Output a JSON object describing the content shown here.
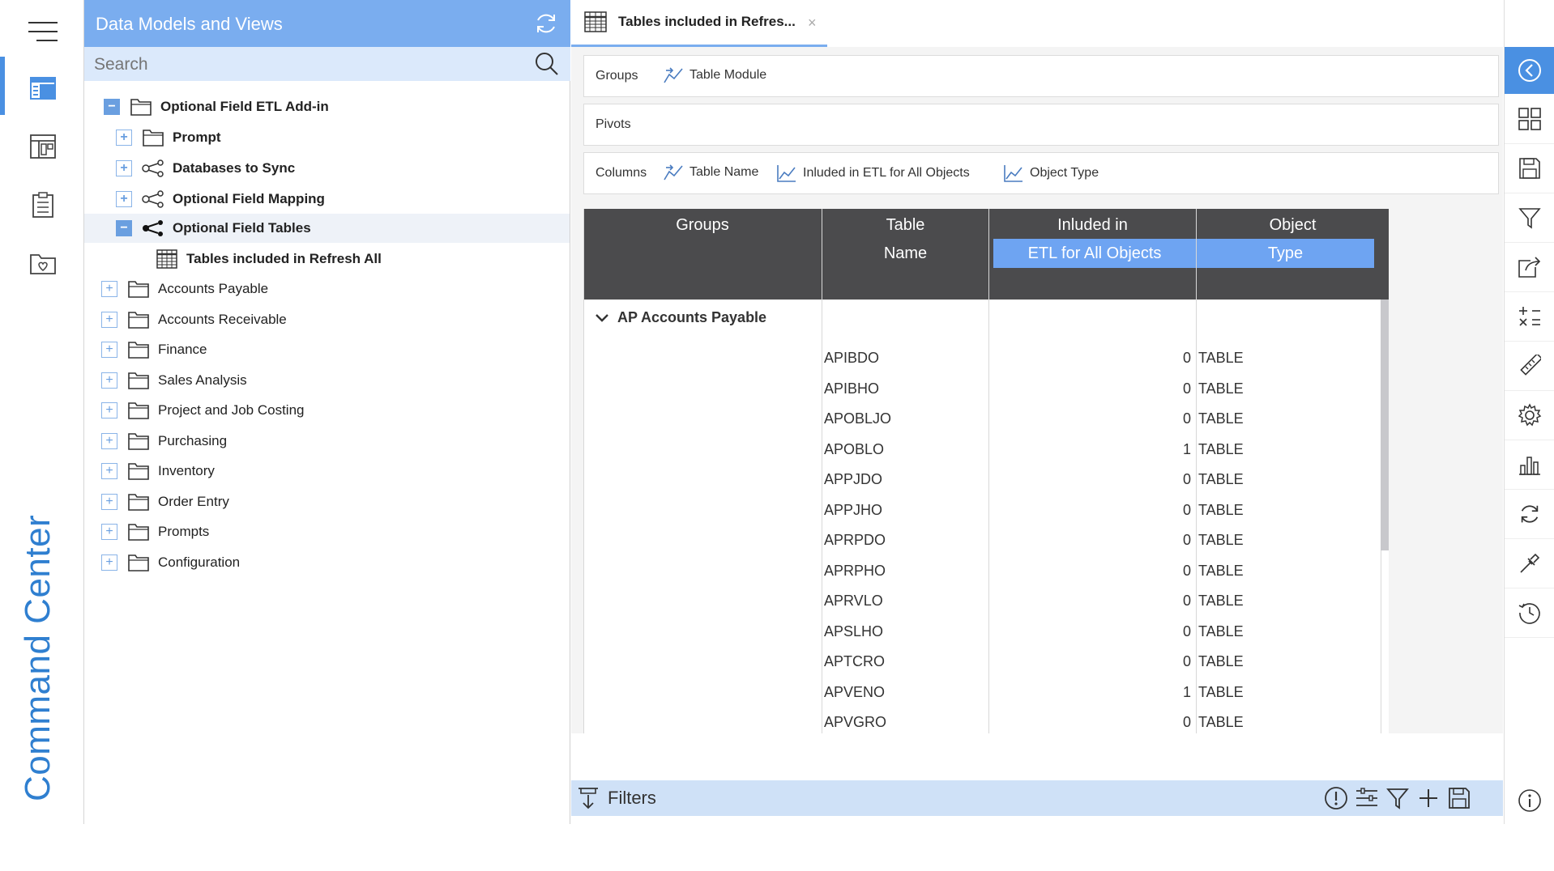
{
  "rail": {
    "title": "Command Center",
    "items": [
      "menu-icon",
      "data-models-icon",
      "dashboard-icon",
      "clipboard-icon",
      "favorites-folder-icon"
    ],
    "accent": "#2f7fd0"
  },
  "tree_panel": {
    "title": "Data Models and Views",
    "search_placeholder": "Search",
    "items": [
      {
        "label": "Optional Field ETL Add-in",
        "expanded": true,
        "icon": "folder-icon"
      },
      {
        "label": "Prompt",
        "expanded": false,
        "icon": "folder-icon"
      },
      {
        "label": "Databases to Sync",
        "expanded": false,
        "icon": "share-node-icon"
      },
      {
        "label": "Optional Field Mapping",
        "expanded": false,
        "icon": "share-node-icon"
      },
      {
        "label": "Optional Field Tables",
        "expanded": true,
        "icon": "share-node-icon"
      },
      {
        "label": "Tables included in Refresh All",
        "icon": "grid-table-icon"
      },
      {
        "label": "Accounts Payable",
        "expanded": false,
        "icon": "folder-icon"
      },
      {
        "label": "Accounts Receivable",
        "expanded": false,
        "icon": "folder-icon"
      },
      {
        "label": "Finance",
        "expanded": false,
        "icon": "folder-icon"
      },
      {
        "label": "Sales Analysis",
        "expanded": false,
        "icon": "folder-icon"
      },
      {
        "label": "Project and Job Costing",
        "expanded": false,
        "icon": "folder-icon"
      },
      {
        "label": "Purchasing",
        "expanded": false,
        "icon": "folder-icon"
      },
      {
        "label": "Inventory",
        "expanded": false,
        "icon": "folder-icon"
      },
      {
        "label": "Order Entry",
        "expanded": false,
        "icon": "folder-icon"
      },
      {
        "label": "Prompts",
        "expanded": false,
        "icon": "folder-icon"
      },
      {
        "label": "Configuration",
        "expanded": false,
        "icon": "folder-icon"
      }
    ],
    "header_color": "#7aadef"
  },
  "tab": {
    "label": "Tables included in Refres...",
    "close": "×"
  },
  "zones": {
    "groups_label": "Groups",
    "groups_chips": [
      "Table Module"
    ],
    "pivots_label": "Pivots",
    "columns_label": "Columns",
    "columns_chips": [
      "Table Name",
      "Inluded in ETL for All Objects",
      "Object Type"
    ]
  },
  "grid": {
    "headers": {
      "groups": "Groups",
      "table_line1": "Table",
      "table_line2": "Name",
      "included_line1": "Inluded in",
      "included_line2": "ETL for All Objects",
      "object_line1": "Object",
      "object_line2": "Type"
    },
    "group_label": "AP Accounts Payable",
    "rows": [
      {
        "table": "APIBDO",
        "included": 0,
        "type": "TABLE"
      },
      {
        "table": "APIBHO",
        "included": 0,
        "type": "TABLE"
      },
      {
        "table": "APOBLJO",
        "included": 0,
        "type": "TABLE"
      },
      {
        "table": "APOBLO",
        "included": 1,
        "type": "TABLE"
      },
      {
        "table": "APPJDO",
        "included": 0,
        "type": "TABLE"
      },
      {
        "table": "APPJHO",
        "included": 0,
        "type": "TABLE"
      },
      {
        "table": "APRPDO",
        "included": 0,
        "type": "TABLE"
      },
      {
        "table": "APRPHO",
        "included": 0,
        "type": "TABLE"
      },
      {
        "table": "APRVLO",
        "included": 0,
        "type": "TABLE"
      },
      {
        "table": "APSLHO",
        "included": 0,
        "type": "TABLE"
      },
      {
        "table": "APTCRO",
        "included": 0,
        "type": "TABLE"
      },
      {
        "table": "APVENO",
        "included": 1,
        "type": "TABLE"
      },
      {
        "table": "APVGRO",
        "included": 0,
        "type": "TABLE"
      }
    ],
    "header_bg": "#4b4b4d",
    "highlight": "#6ea4f2"
  },
  "filters": {
    "label": "Filters",
    "icons": [
      "alert-circle-icon",
      "list-settings-icon",
      "filter-icon",
      "plus-icon",
      "save-icon"
    ],
    "bg": "#cfe1f7"
  },
  "right_toolbar": {
    "icons": [
      "collapse-left-icon",
      "layout-grid-icon",
      "save-icon",
      "filter-icon",
      "export-icon",
      "calculator-icon",
      "ruler-icon",
      "settings-icon",
      "bar-chart-icon",
      "refresh-icon",
      "eyedropper-icon",
      "history-icon",
      "info-icon"
    ],
    "accent": "#4a90e2"
  }
}
